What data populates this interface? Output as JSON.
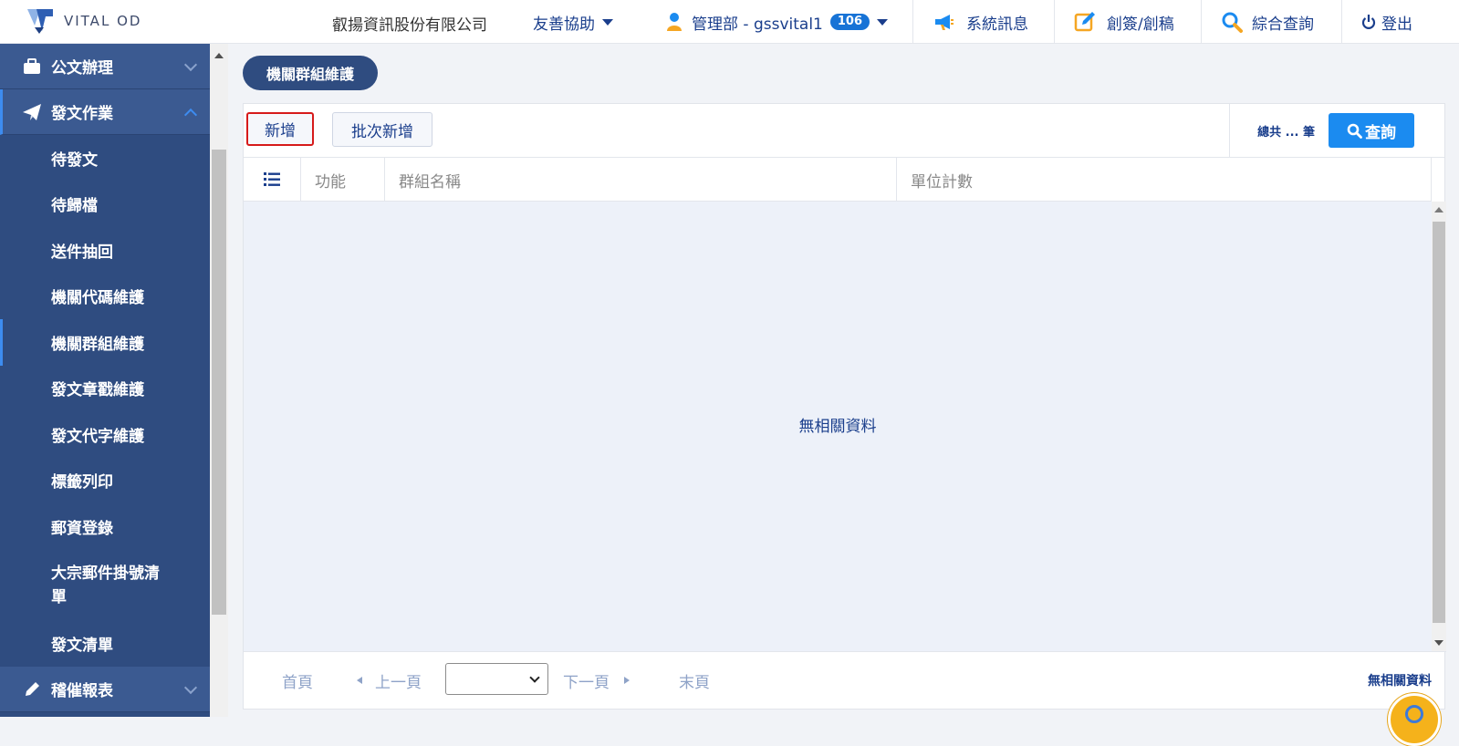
{
  "header": {
    "logo_text": "VITAL OD",
    "company": "叡揚資訊股份有限公司",
    "help": "友善協助",
    "user": "管理部 - gssvital1",
    "user_badge": "106",
    "messages": "系統訊息",
    "compose": "創簽/創稿",
    "search": "綜合查詢",
    "logout": "登出"
  },
  "sidebar": {
    "sections": [
      {
        "label": "公文辦理"
      },
      {
        "label": "發文作業"
      },
      {
        "label": "稽催報表"
      }
    ],
    "items": [
      {
        "label": "待發文"
      },
      {
        "label": "待歸檔"
      },
      {
        "label": "送件抽回"
      },
      {
        "label": "機關代碼維護"
      },
      {
        "label": "機關群組維護"
      },
      {
        "label": "發文章戳維護"
      },
      {
        "label": "發文代字維護"
      },
      {
        "label": "標籤列印"
      },
      {
        "label": "郵資登錄"
      },
      {
        "label": "大宗郵件掛號清單"
      },
      {
        "label": "發文清單"
      }
    ]
  },
  "page": {
    "title": "機關群組維護"
  },
  "toolbar": {
    "add": "新增",
    "batch_add": "批次新增",
    "total": "總共 ... 筆",
    "query": "查詢"
  },
  "table": {
    "columns": [
      "功能",
      "群組名稱",
      "單位計數"
    ],
    "empty": "無相關資料"
  },
  "pager": {
    "first": "首頁",
    "prev": "上一頁",
    "next": "下一頁",
    "last": "末頁",
    "status": "無相關資料",
    "selected_page": ""
  },
  "colors": {
    "sidebar": "#2f4c80",
    "accent": "#1b8bf0",
    "highlight": "#d61a1a",
    "brand_text": "#1a3e8c"
  }
}
